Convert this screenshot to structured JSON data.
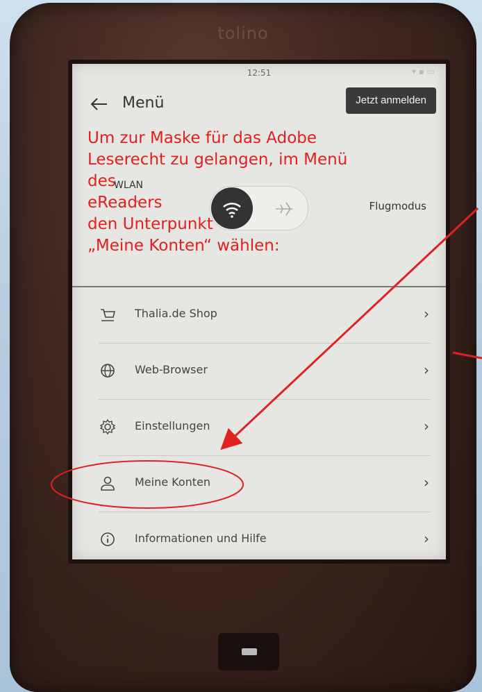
{
  "device": {
    "brand": "tolino"
  },
  "status": {
    "time": "12:51"
  },
  "header": {
    "title": "Menü",
    "login_label": "Jetzt anmelden"
  },
  "toggle": {
    "wlan_label": "WLAN",
    "wlan_sub": "•",
    "flug_label": "Flugmodus"
  },
  "annotation": {
    "lines": [
      "Um zur Maske für das Adobe",
      "Leserecht zu gelangen, im Menü",
      "des",
      "eReaders",
      "den Unterpunkt",
      "„Meine Konten“ wählen:"
    ],
    "color": "#e0211f"
  },
  "menu": {
    "items": [
      {
        "icon": "cart-icon",
        "label": "Thalia.de Shop"
      },
      {
        "icon": "globe-icon",
        "label": "Web-Browser"
      },
      {
        "icon": "gear-icon",
        "label": "Einstellungen"
      },
      {
        "icon": "user-icon",
        "label": "Meine Konten"
      },
      {
        "icon": "info-icon",
        "label": "Informationen und Hilfe"
      }
    ],
    "chevron": "›"
  }
}
